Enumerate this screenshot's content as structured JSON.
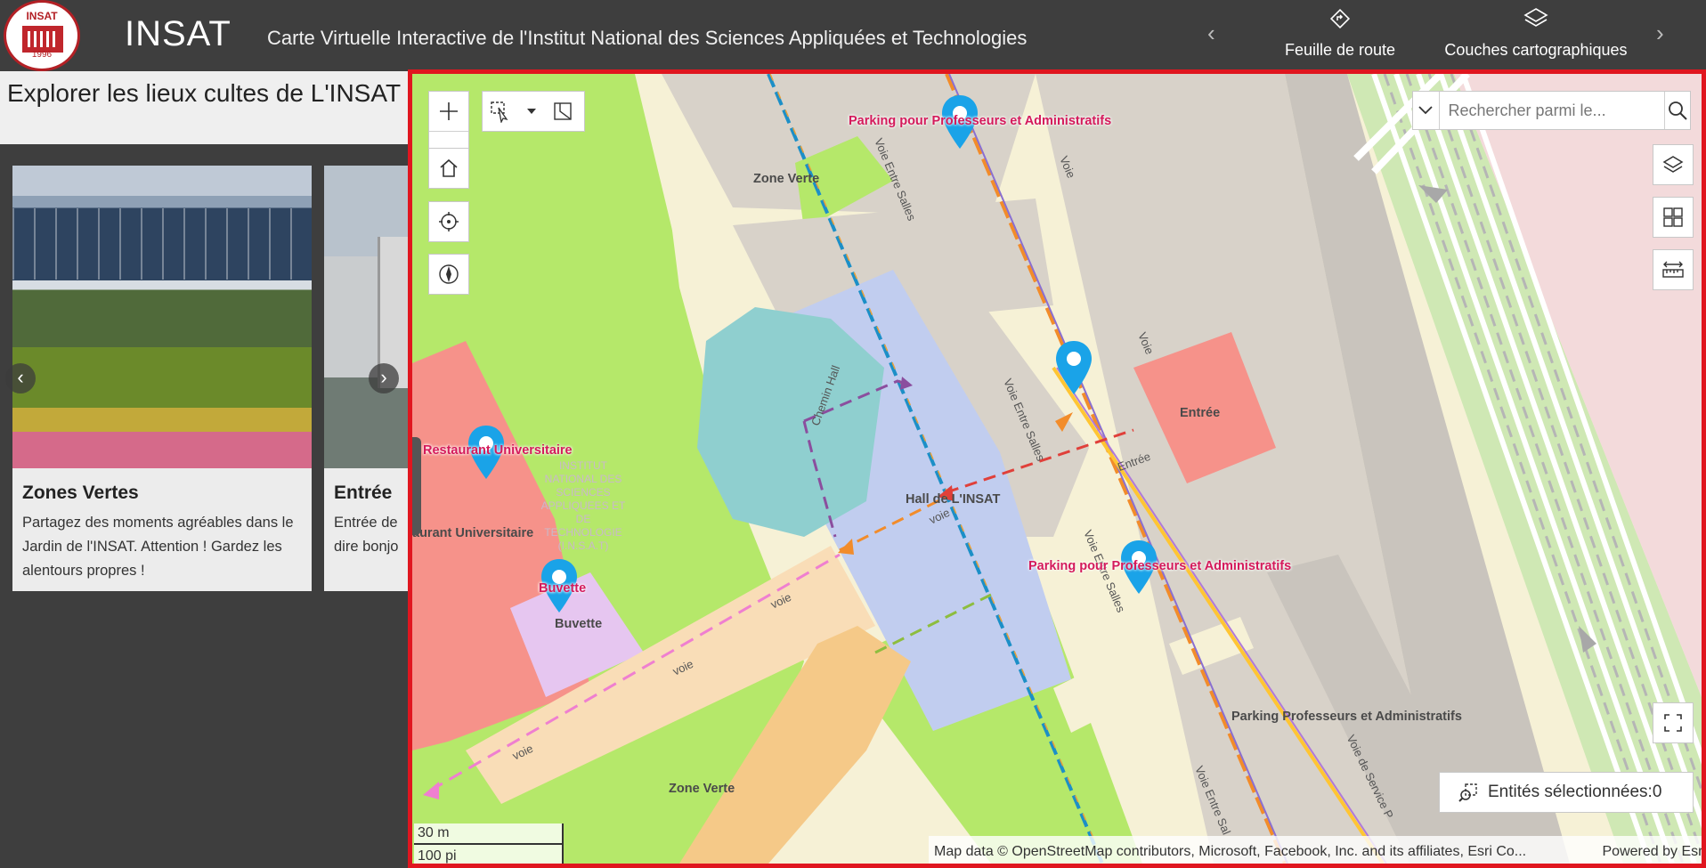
{
  "header": {
    "logo_text": "INSAT",
    "logo_year": "1996",
    "title": "INSAT",
    "subtitle": "Carte Virtuelle Interactive de l'Institut National des Sciences Appliquées et Technologies",
    "nav_prev": "‹",
    "nav_next": "›",
    "buttons": [
      {
        "label": "Feuille de route",
        "icon": "roadmap-icon"
      },
      {
        "label": "Couches cartographiques",
        "icon": "layers-icon"
      }
    ]
  },
  "panel": {
    "title": "Explorer les lieux cultes de L'INSAT",
    "prev": "‹",
    "next": "›",
    "cards": [
      {
        "title": "Zones Vertes",
        "text": "Partagez des moments agréables dans le Jardin de l'INSAT. Attention ! Gardez les alentours propres !"
      },
      {
        "title": "Entrée",
        "text": "Entrée de",
        "text2": "dire bonjo"
      }
    ]
  },
  "map": {
    "search_placeholder": "Rechercher parmi le...",
    "selected_entities": "Entités sélectionnées:0",
    "scale_metric": "30 m",
    "scale_imperial": "100 pi",
    "attribution": "Map data © OpenStreetMap contributors, Microsoft, Facebook, Inc. and its affiliates, Esri Co...",
    "powered_by": "Powered by Esri",
    "labels": {
      "zone_verte_top": "Zone Verte",
      "zone_verte_bottom": "Zone Verte",
      "hall": "Hall de L'INSAT",
      "entree": "Entrée",
      "buvette": "Buvette",
      "restaurant_partial": "aurant Universitaire",
      "parking_bottom": "Parking Professeurs et Administratifs",
      "insat_block": "INSTITUT NATIONAL DES SCIENCES APPLIQUEES ET DE TECHNOLOGIE (I.N.S.A.T)"
    },
    "poi": {
      "parking_top": "Parking pour Professeurs et Administratifs",
      "parking_mid": "Parking pour Professeurs et Administratifs",
      "restaurant": "Restaurant Universitaire",
      "buvette": "Buvette"
    },
    "roads": {
      "voie_entre_salles_1": "Voie Entre Salles",
      "voie_entre_salles_2": "Voie Entre Salles",
      "voie_entre_salles_3": "Voie Entre Salles",
      "voie_entre_salles_4": "Voie Entre Sal",
      "voie_1": "Voie",
      "voie_2": "Voie",
      "voie_orange": "voie",
      "voie_pink_1": "voie",
      "voie_pink_2": "voie",
      "voie_pink_3": "voie",
      "entree_path": "Entrée",
      "chemin_hall": "Chemin Hall",
      "voie_service": "Voie de Service P"
    },
    "colors": {
      "frame_border": "#e0161f",
      "poi_pin": "#1aa3e8",
      "poi_label": "#d41a5b",
      "green_zone": "#b5e86a",
      "building_blue": "#c1cdef",
      "restaurant_red": "#f6928a"
    }
  }
}
